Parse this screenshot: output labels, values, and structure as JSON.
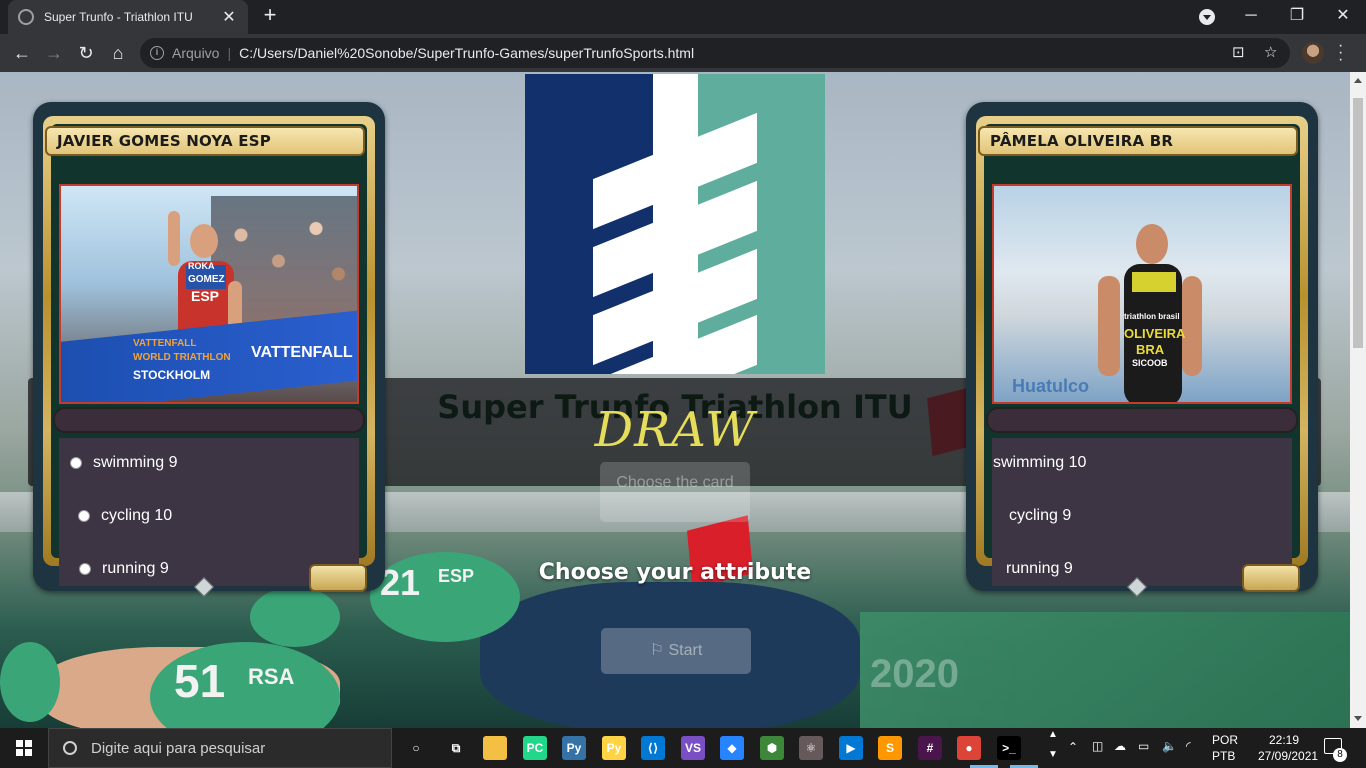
{
  "browser": {
    "tab_title": "Super Trunfo - Triathlon ITU",
    "tab_close": "✕",
    "new_tab": "+",
    "win_min": "─",
    "win_max": "❐",
    "win_close": "✕",
    "nav_back": "←",
    "nav_forward": "→",
    "nav_reload": "↻",
    "nav_home": "⌂",
    "scheme_label": "Arquivo",
    "url": "C:/Users/Daniel%20Sonobe/SuperTrunfo-Games/superTrunfoSports.html",
    "translate_icon": "⊡",
    "star_icon": "☆"
  },
  "page": {
    "title": "Super Trunfo Triathlon ITU",
    "result": "DRAW",
    "choose_card_button": "Choose the card",
    "attribute_prompt": "Choose your attribute",
    "start_button": "⚐ Start"
  },
  "player_card": {
    "name": "JAVIER GOMES NOYA ESP",
    "photo_texts": {
      "bib_brand": "ROKA",
      "bib_name": "GOMEZ",
      "bib_country": "ESP",
      "banner_line1": "VATTENFALL",
      "banner_line2": "WORLD TRIATHLON",
      "banner_line3": "STOCKHOLM",
      "banner_sponsor": "VATTENFALL"
    },
    "attributes": [
      {
        "label": "swimming 9"
      },
      {
        "label": "cycling 10"
      },
      {
        "label": "running 9"
      }
    ]
  },
  "machine_card": {
    "name": "PÂMELA OLIVEIRA BR",
    "photo_texts": {
      "suit_brand": "triathlon brasil",
      "suit_name": "OLIVEIRA",
      "suit_country": "BRA",
      "suit_sponsor": "SICOOB",
      "banner": "Huatulco"
    },
    "attributes": [
      {
        "label": "swimming 10"
      },
      {
        "label": "cycling 9"
      },
      {
        "label": "running 9"
      }
    ]
  },
  "background_texts": {
    "cap1": "21",
    "cap1_small": "ESP",
    "cap2": "51",
    "cap2_small": "RSA",
    "fence": "2020"
  },
  "taskbar": {
    "search_placeholder": "Digite aqui para pesquisar",
    "lang_line1": "POR",
    "lang_line2": "PTB",
    "time": "22:19",
    "date": "27/09/2021",
    "notification_count": "8",
    "pinned": [
      {
        "name": "cortana",
        "label": "○",
        "color": "#1c1c1c"
      },
      {
        "name": "task-view",
        "label": "⧉",
        "color": "#1c1c1c"
      },
      {
        "name": "file-explorer",
        "label": "",
        "color": "#f3c044"
      },
      {
        "name": "pycharm",
        "label": "PC",
        "color": "#21d789"
      },
      {
        "name": "python",
        "label": "Py",
        "color": "#3572a5"
      },
      {
        "name": "python-idle",
        "label": "Py",
        "color": "#ffd343"
      },
      {
        "name": "vscode",
        "label": "⟨⟩",
        "color": "#0078d4"
      },
      {
        "name": "visual-studio",
        "label": "VS",
        "color": "#7b4fc4"
      },
      {
        "name": "sourcetree",
        "label": "◆",
        "color": "#2684ff"
      },
      {
        "name": "nodejs",
        "label": "⬢",
        "color": "#3c873a"
      },
      {
        "name": "atom",
        "label": "⚛",
        "color": "#66595c"
      },
      {
        "name": "azure-data-studio",
        "label": "▶",
        "color": "#0078d4"
      },
      {
        "name": "sublime-text",
        "label": "S",
        "color": "#ff9800"
      },
      {
        "name": "slack",
        "label": "#",
        "color": "#4a154b"
      },
      {
        "name": "chrome",
        "label": "●",
        "color": "#db4437"
      },
      {
        "name": "terminal",
        "label": ">_",
        "color": "#000000"
      }
    ]
  }
}
